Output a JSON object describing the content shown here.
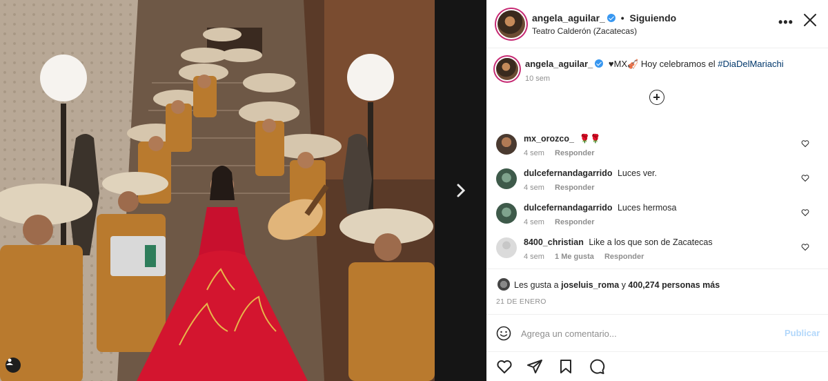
{
  "post": {
    "image_alt": "Angela Aguilar with mariachi band on staircase",
    "next_icon": "chevron-right-icon"
  },
  "header": {
    "username": "angela_aguilar_",
    "separator": "•",
    "follow_status": "Siguiendo",
    "location": "Teatro Calderón (Zacatecas)",
    "more_icon": "more-icon",
    "more_label": "•••",
    "close_icon": "close-icon"
  },
  "caption": {
    "username": "angela_aguilar_",
    "text": "♥MX🎻 Hoy celebramos el",
    "hashtag": "#DiaDelMariachi",
    "time": "10 sem"
  },
  "comments": [
    {
      "username": "mx_orozco_",
      "text": "🌹🌹",
      "time": "4 sem",
      "likes": "",
      "reply": "Responder"
    },
    {
      "username": "dulcefernandagarrido",
      "text": "Luces ver.",
      "time": "4 sem",
      "likes": "",
      "reply": "Responder"
    },
    {
      "username": "dulcefernandagarrido",
      "text": "Luces hermosa",
      "time": "4 sem",
      "likes": "",
      "reply": "Responder"
    },
    {
      "username": "8400_christian",
      "text": "Like a los que son de Zacatecas",
      "time": "4 sem",
      "likes": "1 Me gusta",
      "reply": "Responder"
    }
  ],
  "likes": {
    "prefix": "Les gusta a",
    "user": "joseluis_roma",
    "middle": "y",
    "count": "400,274 personas más"
  },
  "date": "21 DE ENERO",
  "comment_box": {
    "placeholder": "Agrega un comentario...",
    "publish": "Publicar"
  },
  "colors": {
    "verified": "#3897f0",
    "hashtag": "#00376b",
    "publish_disabled": "#b3d8fb",
    "story_ring": "#c62a73"
  }
}
